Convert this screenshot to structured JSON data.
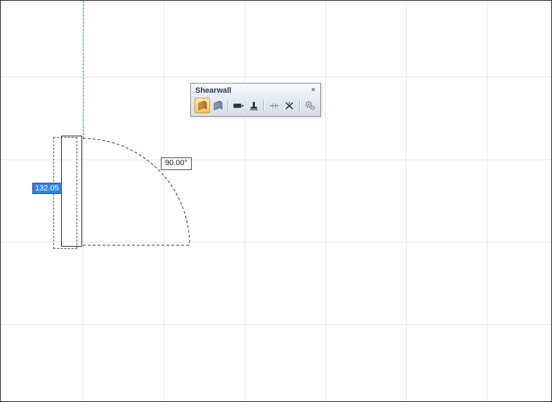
{
  "canvas": {
    "angle_label": "90.00°",
    "dimension_value": "132.05"
  },
  "toolbar": {
    "title": "Shearwall",
    "close_label": "×",
    "icons": [
      {
        "name": "draw-shearwall-icon",
        "selected": true
      },
      {
        "name": "shearwall-secondary-icon",
        "selected": false
      },
      {
        "name": "wall-beam-icon",
        "selected": false
      },
      {
        "name": "wall-column-base-icon",
        "selected": false
      },
      {
        "name": "align-nodes-icon",
        "selected": false
      },
      {
        "name": "delete-shearwall-icon",
        "selected": false
      },
      {
        "name": "settings-gears-icon",
        "selected": false
      }
    ]
  },
  "colors": {
    "selection_blue": "#2e84e2",
    "snap_guide_green": "#00a94f",
    "selected_tool_highlight": "#fcd87c",
    "grid_line": "#e7e7e7"
  }
}
